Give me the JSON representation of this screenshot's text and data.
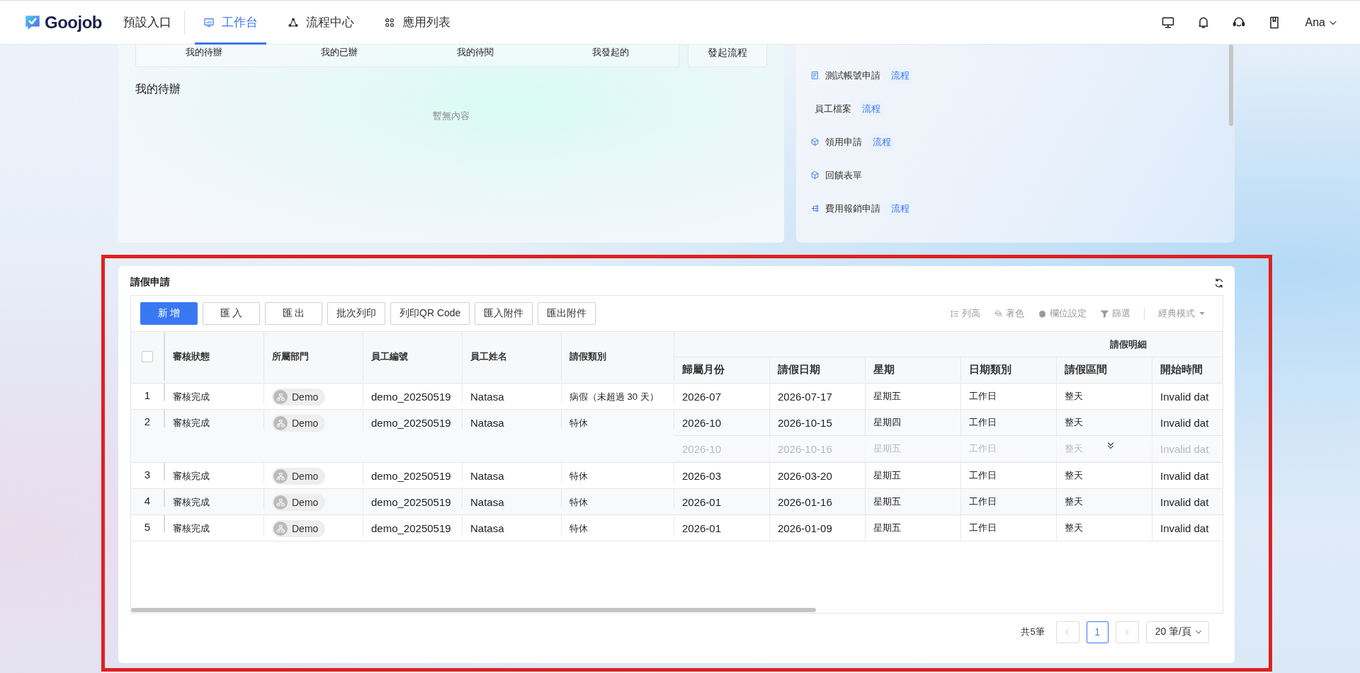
{
  "header": {
    "logo": "Goojob",
    "entry": "預設入口",
    "tabs": [
      {
        "label": "工作台",
        "selected": true,
        "kind": "workbench"
      },
      {
        "label": "流程中心",
        "selected": false,
        "kind": "flow"
      },
      {
        "label": "應用列表",
        "selected": false,
        "kind": "apps"
      }
    ],
    "user": "Ana"
  },
  "workbench": {
    "stats": [
      "我的待辦",
      "我的已辦",
      "我的待閱",
      "我發起的"
    ],
    "start_button": "發起流程",
    "section_title": "我的待辦",
    "empty_text": "暫無內容"
  },
  "app_list": {
    "items": [
      {
        "label": "測試帳號申請",
        "tag": "流程",
        "kind": "form"
      },
      {
        "label": "員工檔案",
        "tag": "流程",
        "kind": "plain"
      },
      {
        "label": "領用申請",
        "tag": "流程",
        "kind": "box"
      },
      {
        "label": "回饋表單",
        "kind": "cube"
      },
      {
        "label": "費用報銷申請",
        "tag": "流程",
        "kind": "flow"
      }
    ]
  },
  "leave_card": {
    "title": "請假申請",
    "buttons": [
      {
        "label": "新 增",
        "kind": "primary"
      },
      {
        "label": "匯 入",
        "kind": "default"
      },
      {
        "label": "匯 出",
        "kind": "default"
      },
      {
        "label": "批次列印",
        "kind": "default"
      },
      {
        "label": "列印QR Code",
        "kind": "default"
      },
      {
        "label": "匯入附件",
        "kind": "default"
      },
      {
        "label": "匯出附件",
        "kind": "default"
      }
    ],
    "tools": [
      {
        "label": "列高",
        "kind": "row-height"
      },
      {
        "label": "著色",
        "kind": "color"
      },
      {
        "label": "欄位設定",
        "kind": "settings"
      },
      {
        "label": "篩選",
        "kind": "filter"
      }
    ],
    "view_mode": "經典模式",
    "table": {
      "select_all": {
        "checked": false
      },
      "columns": [
        "審核狀態",
        "所屬部門",
        "員工編號",
        "員工姓名",
        "請假類別"
      ],
      "group": "請假明細",
      "detail_columns": [
        "歸屬月份",
        "請假日期",
        "星期",
        "日期類別",
        "請假區間",
        "開始時間"
      ],
      "rows": [
        {
          "index": "1",
          "status": "審核完成",
          "department": "Demo",
          "employee_id": "demo_20250519",
          "name": "Natasa",
          "leave_type": "病假（未超過 30 天）",
          "more": false,
          "details": [
            {
              "cells": [
                "2026-07",
                "2026-07-17",
                "星期五",
                "工作日",
                "整天",
                "Invalid dat"
              ],
              "faded": false
            }
          ]
        },
        {
          "index": "2",
          "status": "審核完成",
          "department": "Demo",
          "employee_id": "demo_20250519",
          "name": "Natasa",
          "leave_type": "特休",
          "more": true,
          "details": [
            {
              "cells": [
                "2026-10",
                "2026-10-15",
                "星期四",
                "工作日",
                "整天",
                "Invalid dat"
              ],
              "faded": false
            },
            {
              "cells": [
                "2026-10",
                "2026-10-16",
                "星期五",
                "工作日",
                "整天",
                "Invalid dat"
              ],
              "faded": true
            }
          ]
        },
        {
          "index": "3",
          "status": "審核完成",
          "department": "Demo",
          "employee_id": "demo_20250519",
          "name": "Natasa",
          "leave_type": "特休",
          "more": false,
          "details": [
            {
              "cells": [
                "2026-03",
                "2026-03-20",
                "星期五",
                "工作日",
                "整天",
                "Invalid dat"
              ],
              "faded": false
            }
          ]
        },
        {
          "index": "4",
          "status": "審核完成",
          "department": "Demo",
          "employee_id": "demo_20250519",
          "name": "Natasa",
          "leave_type": "特休",
          "more": false,
          "details": [
            {
              "cells": [
                "2026-01",
                "2026-01-16",
                "星期五",
                "工作日",
                "整天",
                "Invalid dat"
              ],
              "faded": false
            }
          ]
        },
        {
          "index": "5",
          "status": "審核完成",
          "department": "Demo",
          "employee_id": "demo_20250519",
          "name": "Natasa",
          "leave_type": "特休",
          "more": false,
          "details": [
            {
              "cells": [
                "2026-01",
                "2026-01-09",
                "星期五",
                "工作日",
                "整天",
                "Invalid dat"
              ],
              "faded": false
            }
          ]
        }
      ]
    },
    "pagination": {
      "total": "共5筆",
      "pages": [
        {
          "label": "1",
          "selected": true
        }
      ],
      "page_size": "20 筆/頁"
    }
  }
}
